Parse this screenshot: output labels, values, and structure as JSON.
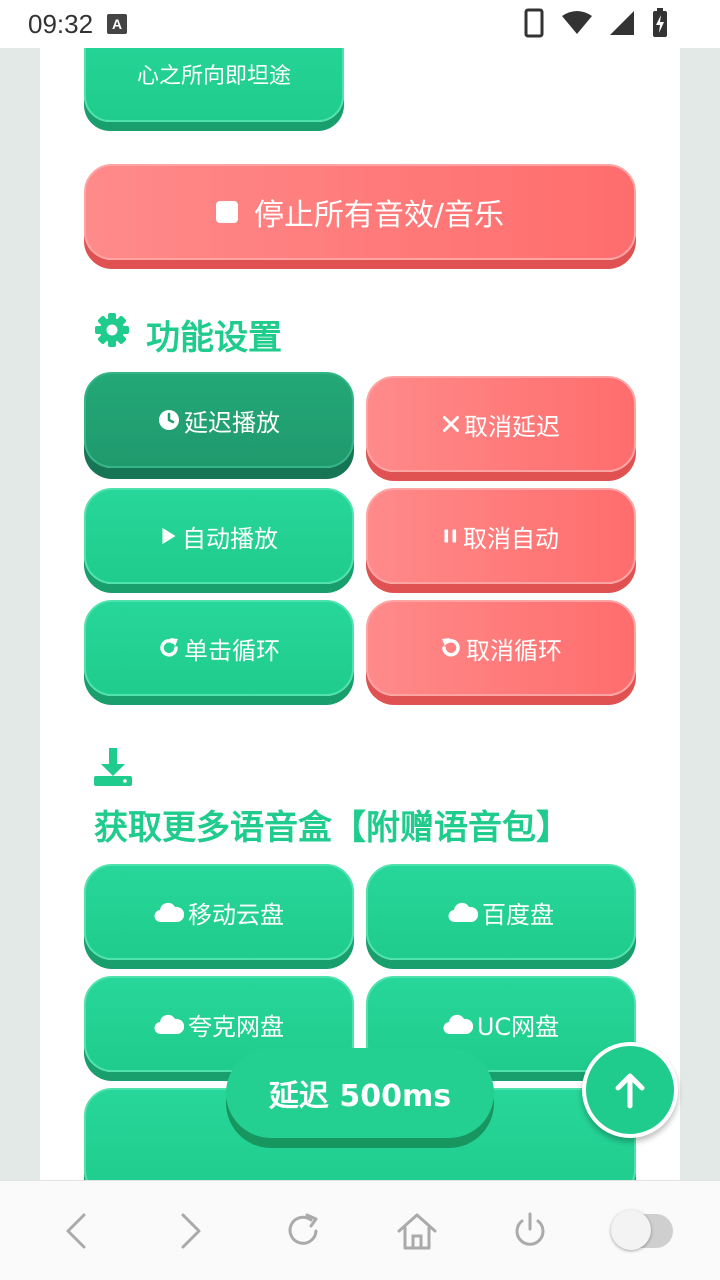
{
  "status_bar": {
    "time": "09:32",
    "notification_badge": "A"
  },
  "top_partial_button": {
    "label": "心之所向即坦途"
  },
  "stop_button": {
    "label": "停止所有音效/音乐"
  },
  "settings": {
    "title": "功能设置",
    "buttons": [
      {
        "label": "延迟播放",
        "icon": "clock-icon",
        "color": "green-dark"
      },
      {
        "label": "取消延迟",
        "icon": "close-icon",
        "color": "red"
      },
      {
        "label": "自动播放",
        "icon": "play-icon",
        "color": "green"
      },
      {
        "label": "取消自动",
        "icon": "pause-icon",
        "color": "red"
      },
      {
        "label": "单击循环",
        "icon": "redo-icon",
        "color": "green"
      },
      {
        "label": "取消循环",
        "icon": "undo-icon",
        "color": "red"
      }
    ]
  },
  "more": {
    "title": "获取更多语音盒【附赠语音包】",
    "buttons": [
      {
        "label": "移动云盘",
        "icon": "cloud-icon"
      },
      {
        "label": "百度盘",
        "icon": "cloud-icon"
      },
      {
        "label": "夸克网盘",
        "icon": "cloud-icon"
      },
      {
        "label": "UC网盘",
        "icon": "cloud-icon"
      }
    ]
  },
  "floating": {
    "delay_label": "延迟 500ms"
  },
  "colors": {
    "green": "#1fcc8d",
    "green_dark": "#1f9a6e",
    "red": "#ff7373",
    "side_bg": "#e3e9e7"
  }
}
